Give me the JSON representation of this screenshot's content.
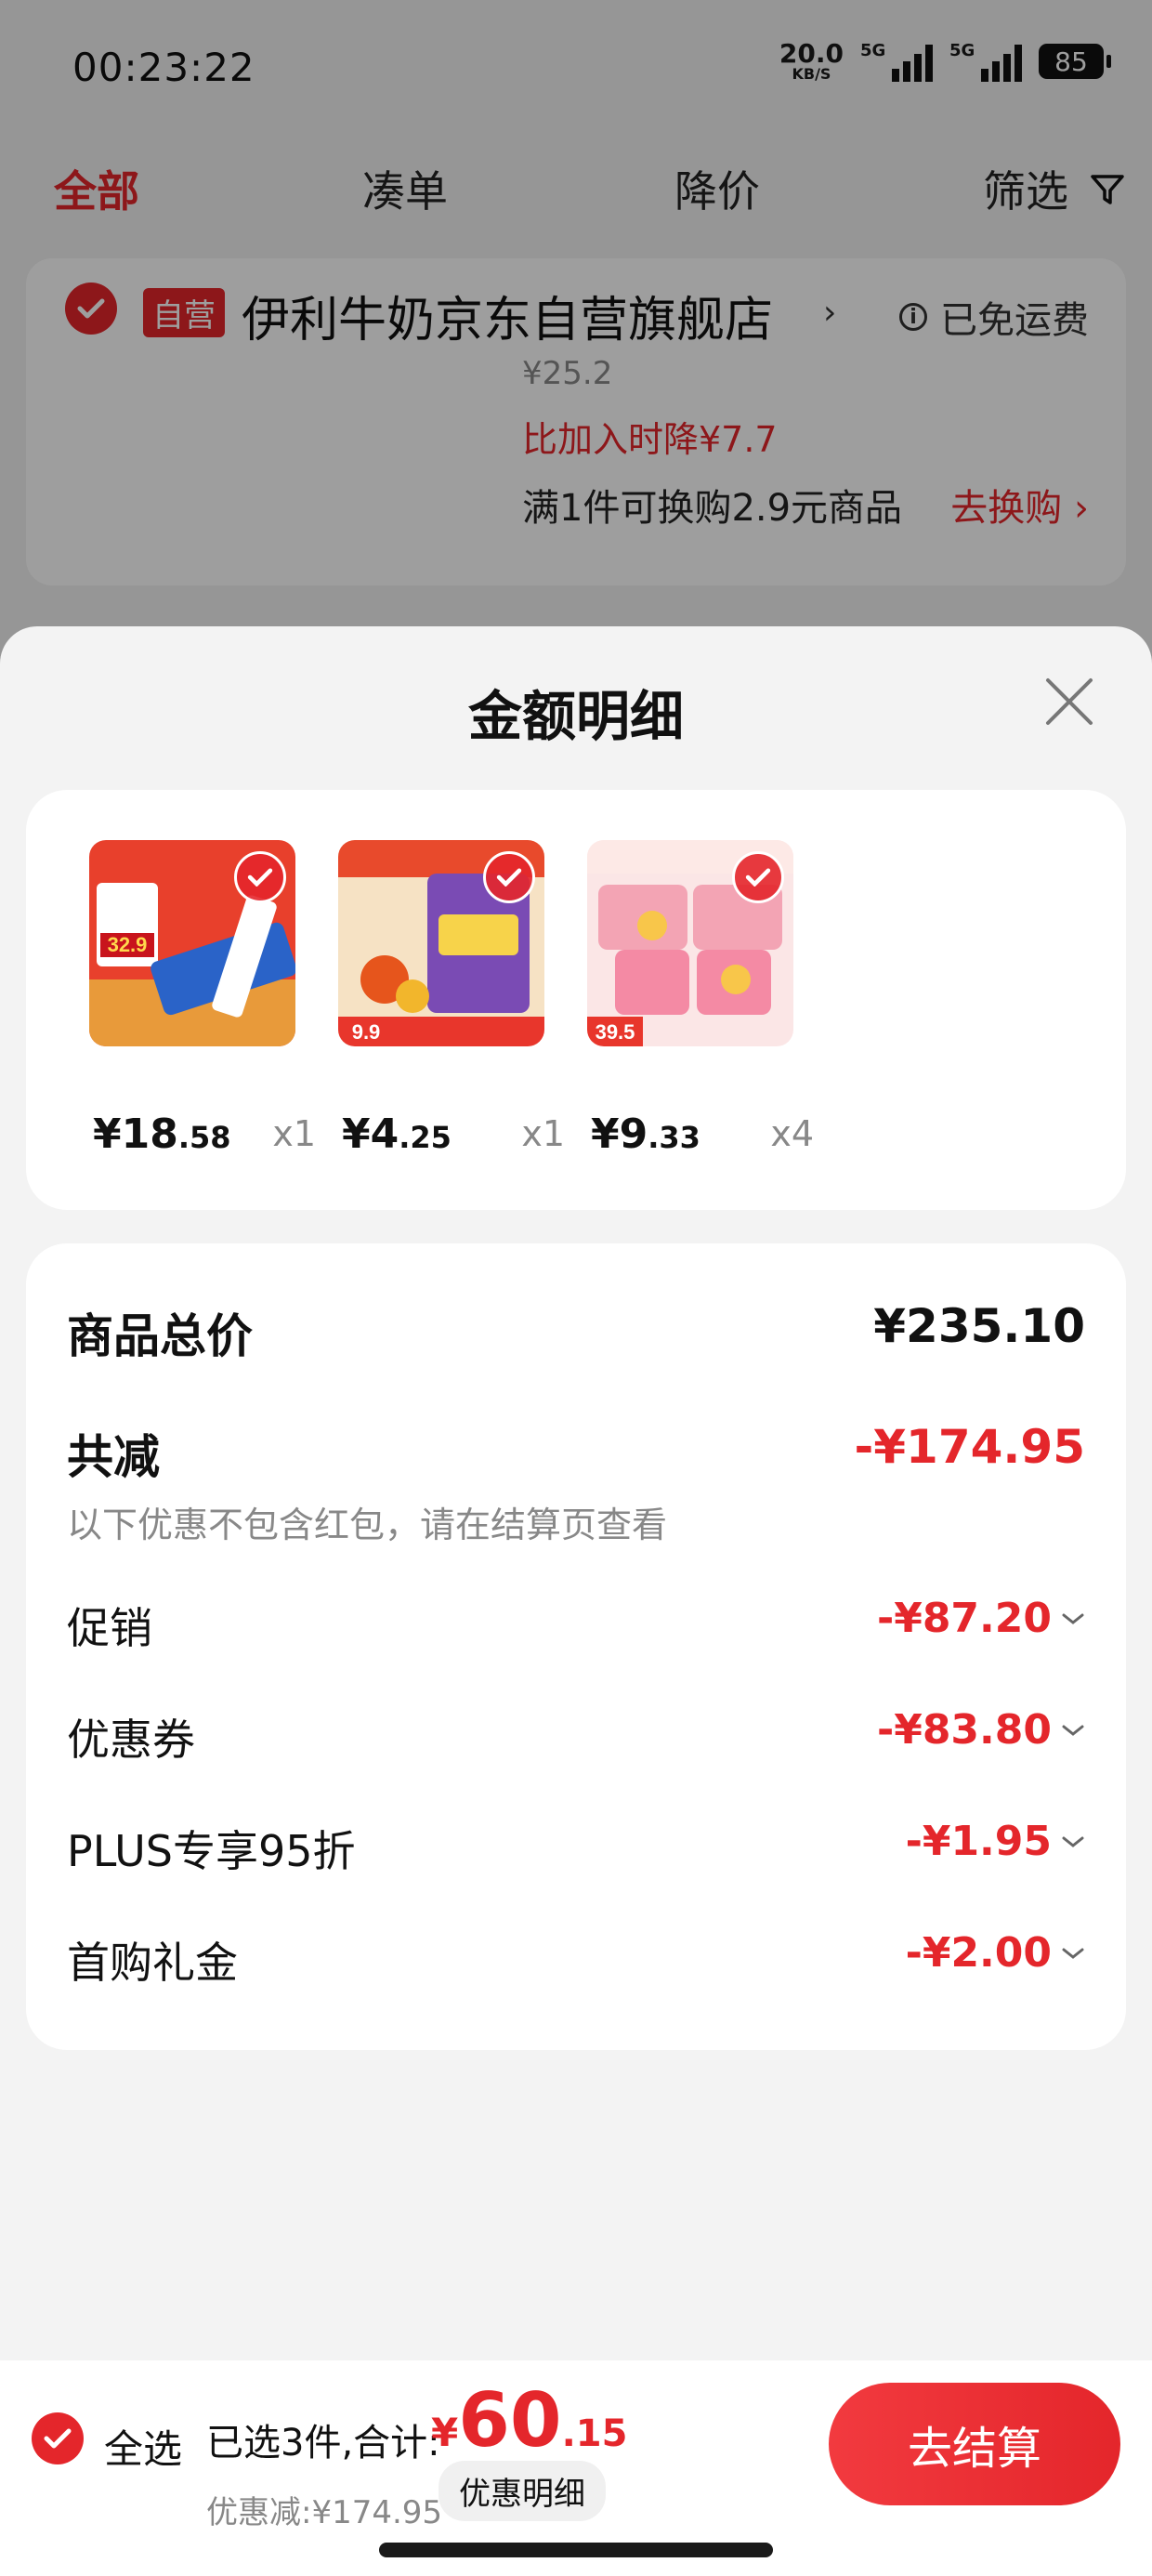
{
  "status_bar": {
    "time": "00:23:22",
    "net_speed_value": "20.0",
    "net_speed_unit": "KB/S",
    "signal_1_label": "5G",
    "signal_2_label": "5G",
    "battery": "85"
  },
  "tabs": [
    {
      "label": "全部",
      "active": true
    },
    {
      "label": "凑单",
      "active": false
    },
    {
      "label": "降价",
      "active": false
    },
    {
      "label": "筛选",
      "active": false
    }
  ],
  "store": {
    "badge": "自营",
    "name": "伊利牛奶京东自营旗舰店",
    "free_shipping": "已免运费",
    "original_price": "¥25.2",
    "price_drop": "比加入时降¥7.7",
    "exchange_text": "满1件可换购2.9元商品",
    "exchange_link": "去换购"
  },
  "sheet": {
    "title": "金额明细",
    "products": [
      {
        "price_currency": "¥",
        "price_int": "18",
        "price_dec": ".58",
        "qty": "x1",
        "thumb_caption": "32.9"
      },
      {
        "price_currency": "¥",
        "price_int": "4",
        "price_dec": ".25",
        "qty": "x1",
        "thumb_caption": "9.9"
      },
      {
        "price_currency": "¥",
        "price_int": "9",
        "price_dec": ".33",
        "qty": "x4",
        "thumb_caption": "39.5"
      }
    ],
    "summary": {
      "total_label": "商品总价",
      "total_value": "¥235.10",
      "reduce_label": "共减",
      "reduce_value": "-¥174.95",
      "note": "以下优惠不包含红包，请在结算页查看",
      "details": [
        {
          "label": "促销",
          "value": "-¥87.20"
        },
        {
          "label": "优惠券",
          "value": "-¥83.80"
        },
        {
          "label": "PLUS专享95折",
          "value": "-¥1.95"
        },
        {
          "label": "首购礼金",
          "value": "-¥2.00"
        }
      ]
    }
  },
  "bottom_bar": {
    "select_all": "全选",
    "selected_count": "已选3件,合计:",
    "total_currency": "¥",
    "total_int": "60",
    "total_dec": ".15",
    "discount_text": "优惠减:¥174.95",
    "detail_button": "优惠明细",
    "checkout_button": "去结算"
  },
  "colors": {
    "accent": "#e4262b",
    "card": "#ffffff",
    "sheet_bg": "#f3f3f3"
  },
  "icons": [
    "check-icon",
    "info-icon",
    "chevron-right-icon",
    "filter-icon",
    "close-icon",
    "chevron-down-icon"
  ]
}
